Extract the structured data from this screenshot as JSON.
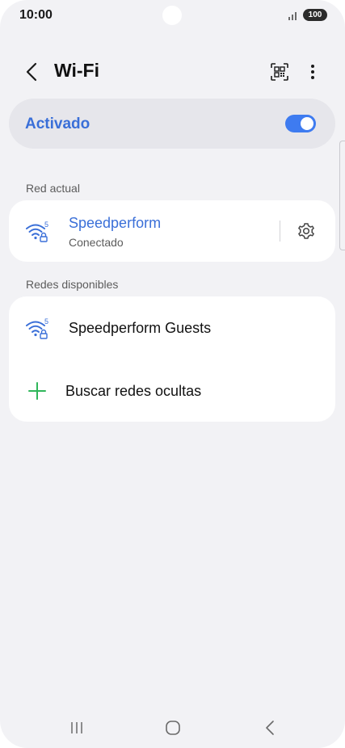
{
  "status_bar": {
    "time": "10:00",
    "battery": "100",
    "icons": [
      "signal-icon",
      "battery-icon"
    ]
  },
  "header": {
    "title": "Wi-Fi",
    "icons": [
      "back-icon",
      "qr-code-icon",
      "more-vertical-icon"
    ]
  },
  "toggle": {
    "label": "Activado",
    "state": "on"
  },
  "current_network": {
    "section_label": "Red actual",
    "name": "Speedperform",
    "status": "Conectado",
    "band_badge": "5",
    "icons": [
      "wifi-5ghz-lock-icon",
      "gear-icon"
    ]
  },
  "available_networks": {
    "section_label": "Redes disponibles",
    "items": [
      {
        "name": "Speedperform Guests",
        "band_badge": "5",
        "icon": "wifi-5ghz-lock-icon"
      }
    ],
    "hidden_search_label": "Buscar redes ocultas"
  },
  "nav_bar": {
    "icons": [
      "recents-icon",
      "home-icon",
      "back-nav-icon"
    ]
  },
  "colors": {
    "accent": "#3e7bf0",
    "accent_text": "#3a6fd8",
    "plus_green": "#2fb65a",
    "background": "#f2f2f5",
    "card": "#ffffff"
  }
}
